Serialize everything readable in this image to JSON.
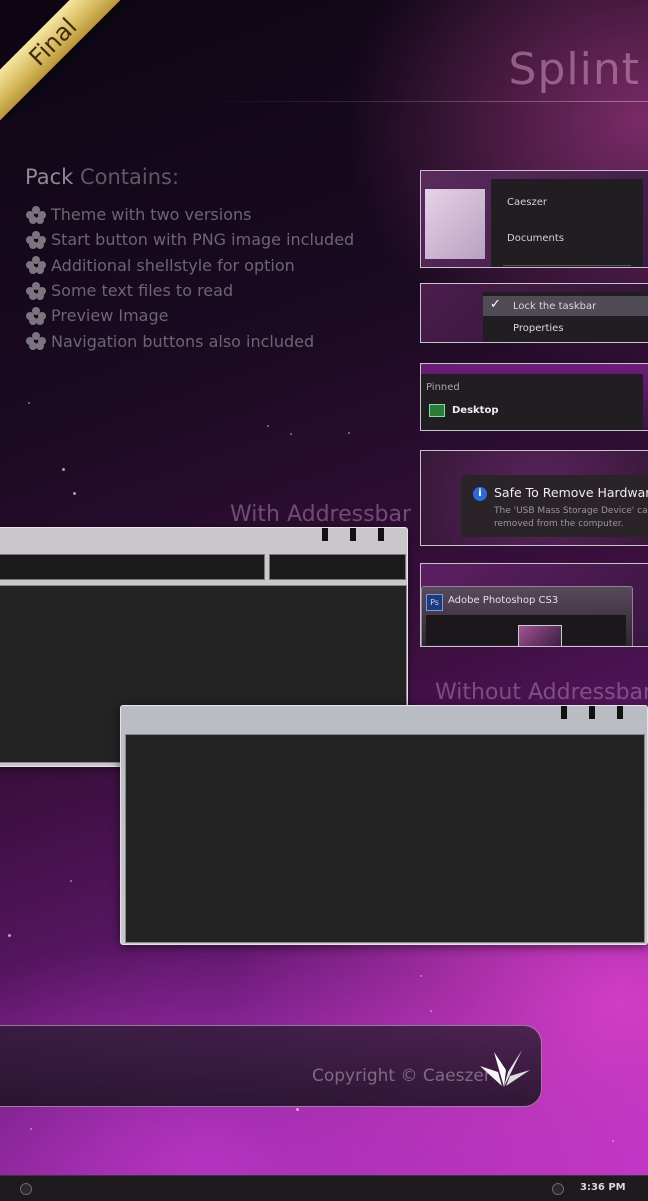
{
  "ribbon": {
    "label": "Final"
  },
  "brand": {
    "title": "Splint"
  },
  "pack": {
    "title_main": "Pack",
    "title_rest": " Contains:",
    "items": [
      "Theme with two versions",
      "Start button with PNG image included",
      "Additional shellstyle for option",
      "Some text files to read",
      "Preview Image",
      "Navigation buttons also included"
    ]
  },
  "previews": {
    "start_menu": {
      "user": "Caeszer",
      "item": "Documents"
    },
    "taskbar_menu": {
      "lock": "Lock the taskbar",
      "properties": "Properties",
      "check": "✓"
    },
    "jumplist": {
      "section": "Pinned",
      "item": "Desktop"
    },
    "notification": {
      "title": "Safe To Remove Hardware",
      "line1": "The 'USB Mass Storage Device' can now be safely",
      "line2": "removed from the computer."
    },
    "thumbnail": {
      "app_icon": "Ps",
      "title": "Adobe Photoshop CS3"
    }
  },
  "captions": {
    "with": "With Addressbar",
    "without": "Without Addressbar"
  },
  "footer": {
    "copyright": "Copyright © Caeszer"
  },
  "taskbar": {
    "clock": "3:36 PM"
  }
}
